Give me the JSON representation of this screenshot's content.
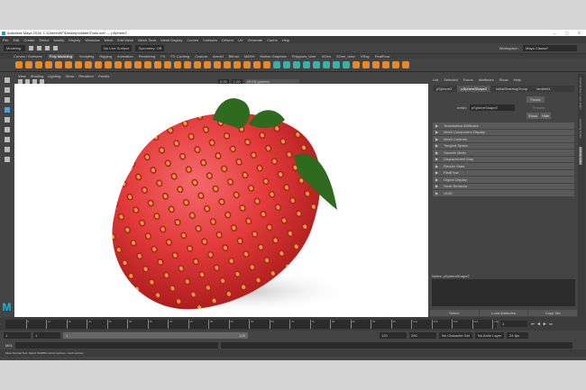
{
  "title": {
    "text": "Autodesk Maya 2018: C:\\Users\\WF\\Desktop\\hiddenTools.ma*  ---  pSphere2",
    "controls": [
      "—",
      "▢",
      "✕"
    ]
  },
  "menu": [
    "File",
    "Edit",
    "Create",
    "Select",
    "Modify",
    "Display",
    "Windows",
    "Mesh",
    "Edit Mesh",
    "Mesh Tools",
    "Mesh Display",
    "Curves",
    "Surfaces",
    "Deform",
    "UV",
    "Generate",
    "Cache",
    "Help"
  ],
  "status": {
    "mode": "Modeling",
    "live": "No Live Surface",
    "symmetry": "Symmetry: Off",
    "workspace_label": "Workspace :",
    "workspace": "Maya Classic*"
  },
  "shelf_tabs": [
    "Curves / Surfaces",
    "Poly Modeling",
    "Sculpting",
    "Rigging",
    "Animation",
    "Rendering",
    "FX",
    "FX Caching",
    "Custom",
    "Arnold",
    "Bifrost",
    "MASH",
    "Motion Graphics",
    "Polygons_User",
    "XGen",
    "XGen_User",
    "VRay",
    "RealFlow"
  ],
  "shelf_active": 1,
  "viewport": {
    "menu": [
      "View",
      "Shading",
      "Lighting",
      "Show",
      "Renderer",
      "Panels"
    ],
    "exposure": "0.00",
    "gamma": "1.00",
    "colorspace": "sRGB gamma"
  },
  "ae": {
    "menu": [
      "List",
      "Selected",
      "Focus",
      "Attributes",
      "Show",
      "Help"
    ],
    "tabs": [
      "pSphere2",
      "pSphereShape2",
      "initialShadingGroup",
      "lambert1"
    ],
    "active_tab": 1,
    "mesh_label": "mesh:",
    "mesh_value": "pSphereShape2",
    "focus": "Focus",
    "presets": "Presets",
    "show": "Show",
    "hide": "Hide",
    "sections": [
      "Tessellation Attributes",
      "Mesh Component Display",
      "Mesh Controls",
      "Tangent Space",
      "Smooth Mesh",
      "Displacement Map",
      "Render Stats",
      "RealFlow",
      "Object Display",
      "Node Behavior",
      "UUID"
    ],
    "notes_label": "Notes:  pSphereShape2",
    "buttons": [
      "Select",
      "Load Attributes",
      "Copy Tab"
    ]
  },
  "side_tabs": [
    "Channel Box / Layer Editor",
    "Modeling Toolkit",
    "Attribute Editor"
  ],
  "timeline": {
    "ticks": [
      "5",
      "10",
      "15",
      "20",
      "25",
      "30",
      "35",
      "40",
      "45",
      "50",
      "55",
      "60",
      "65",
      "70",
      "75",
      "80",
      "85",
      "90",
      "95",
      "100",
      "105",
      "110",
      "115",
      "120"
    ],
    "current": "1"
  },
  "range": {
    "start": "1",
    "playback_start": "1",
    "slider_start": "1",
    "slider_end": "120",
    "playback_end": "120",
    "end": "200",
    "character": "No Character Set",
    "anim_layer": "No Anim Layer",
    "fps": "24 fps"
  },
  "mel": {
    "label": "MEL"
  },
  "help": "Move Normal Tool: Select NURBS control vertices, mesh vertices"
}
